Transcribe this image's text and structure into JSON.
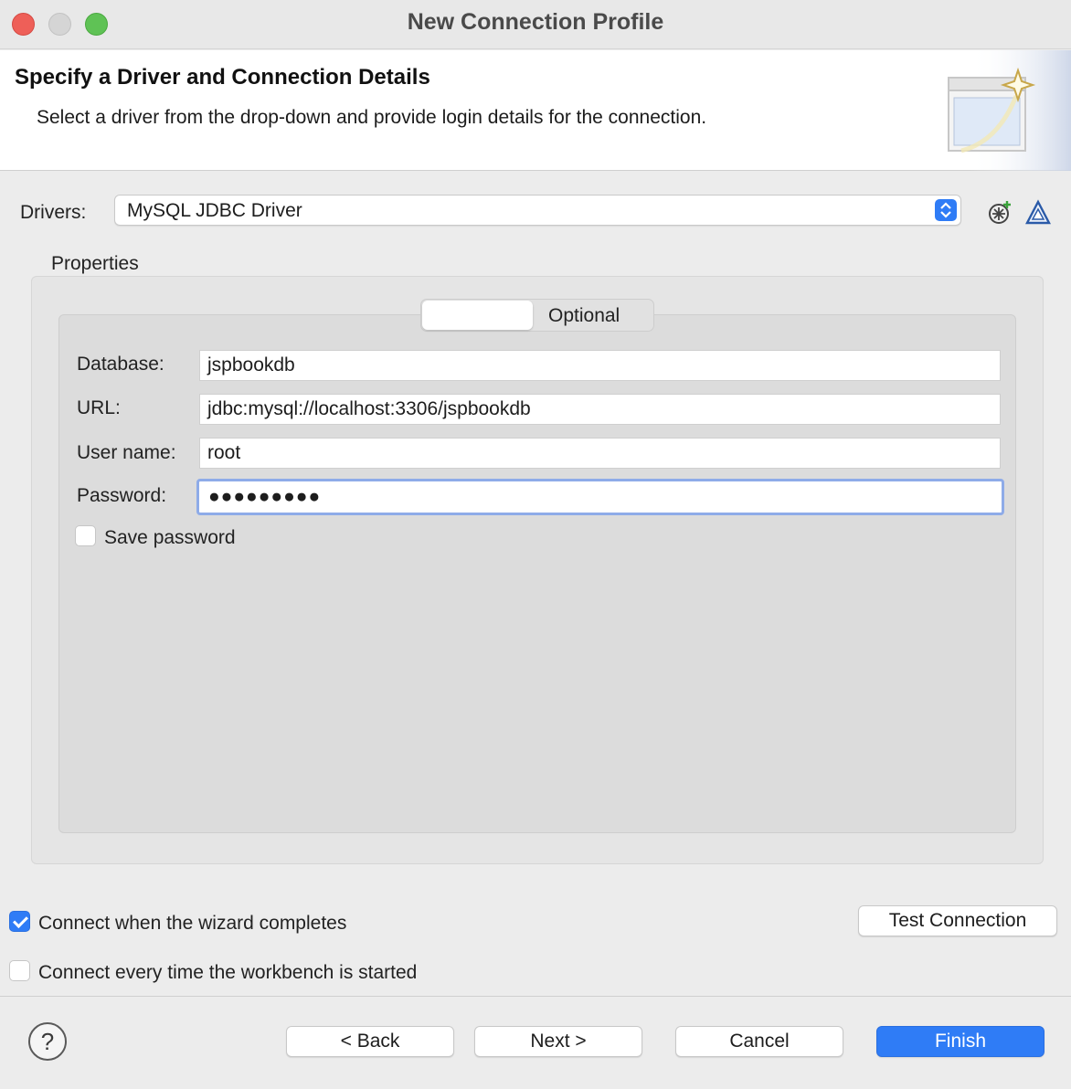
{
  "window": {
    "title": "New Connection Profile"
  },
  "header": {
    "title": "Specify a Driver and Connection Details",
    "description": "Select a driver from the drop-down and provide login details for the connection."
  },
  "drivers": {
    "label": "Drivers:",
    "selected": "MySQL JDBC Driver"
  },
  "properties": {
    "group_label": "Properties",
    "tabs": [
      {
        "label": "",
        "selected": true
      },
      {
        "label": "Optional",
        "selected": false
      }
    ],
    "fields": {
      "database": {
        "label": "Database:",
        "value": "jspbookdb"
      },
      "url": {
        "label": "URL:",
        "value": "jdbc:mysql://localhost:3306/jspbookdb"
      },
      "username": {
        "label": "User name:",
        "value": "root"
      },
      "password": {
        "label": "Password:",
        "value": "●●●●●●●●●"
      }
    },
    "save_password": {
      "label": "Save password",
      "checked": false
    }
  },
  "options": {
    "connect_on_finish": {
      "label": "Connect when the wizard completes",
      "checked": true
    },
    "connect_on_startup": {
      "label": "Connect every time the workbench is started",
      "checked": false
    },
    "test_connection": "Test Connection"
  },
  "footer": {
    "help": "?",
    "back": "< Back",
    "next": "Next >",
    "cancel": "Cancel",
    "finish": "Finish"
  },
  "colors": {
    "accent": "#2f7cf6",
    "focus_ring": "#8eabe8"
  },
  "icons": [
    "new-driver-definition-icon",
    "edit-driver-definition-icon",
    "wizard-banner-icon",
    "help-icon"
  ]
}
